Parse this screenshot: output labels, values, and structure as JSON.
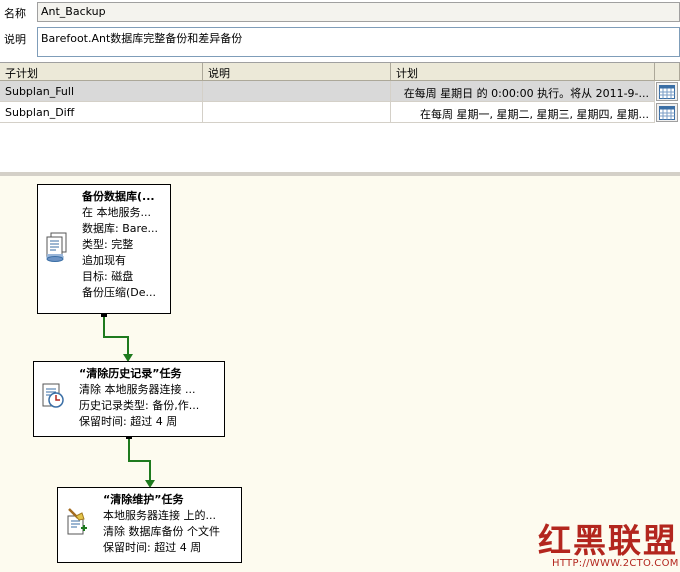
{
  "properties": {
    "name_label": "名称",
    "name_value": "Ant_Backup",
    "desc_label": "说明",
    "desc_value": "Barefoot.Ant数据库完整备份和差异备份"
  },
  "grid": {
    "headers": [
      "子计划",
      "说明",
      "计划"
    ],
    "rows": [
      {
        "subplan": "Subplan_Full",
        "description": "",
        "schedule": "在每周 星期日 的 0:00:00 执行。将从 2011-9-...",
        "selected": true
      },
      {
        "subplan": "Subplan_Diff",
        "description": "",
        "schedule": "在每周 星期一, 星期二, 星期三, 星期四, 星期...",
        "selected": false
      }
    ]
  },
  "tasks": [
    {
      "title": "备份数据库(...",
      "lines": [
        "在 本地服务...",
        "数据库: Bare...",
        "类型: 完整",
        "追加现有",
        "目标: 磁盘",
        "备份压缩(De..."
      ],
      "icon": "backup-database-icon"
    },
    {
      "title": "“清除历史记录”任务",
      "lines": [
        "清除 本地服务器连接 ...",
        "历史记录类型: 备份,作...",
        "保留时间: 超过 4 周"
      ],
      "icon": "history-cleanup-icon"
    },
    {
      "title": "“清除维护”任务",
      "lines": [
        "本地服务器连接 上的...",
        "清除 数据库备份 个文件",
        "保留时间: 超过 4 周"
      ],
      "icon": "maintenance-cleanup-icon"
    }
  ],
  "watermark": {
    "text": "红黑联盟",
    "url": "HTTP://WWW.2CTO.COM"
  },
  "colors": {
    "connector": "#1e7a1e",
    "canvas_bg": "#fdfbef",
    "selected_row": "#d9d9d9",
    "watermark": "#b3261e"
  }
}
